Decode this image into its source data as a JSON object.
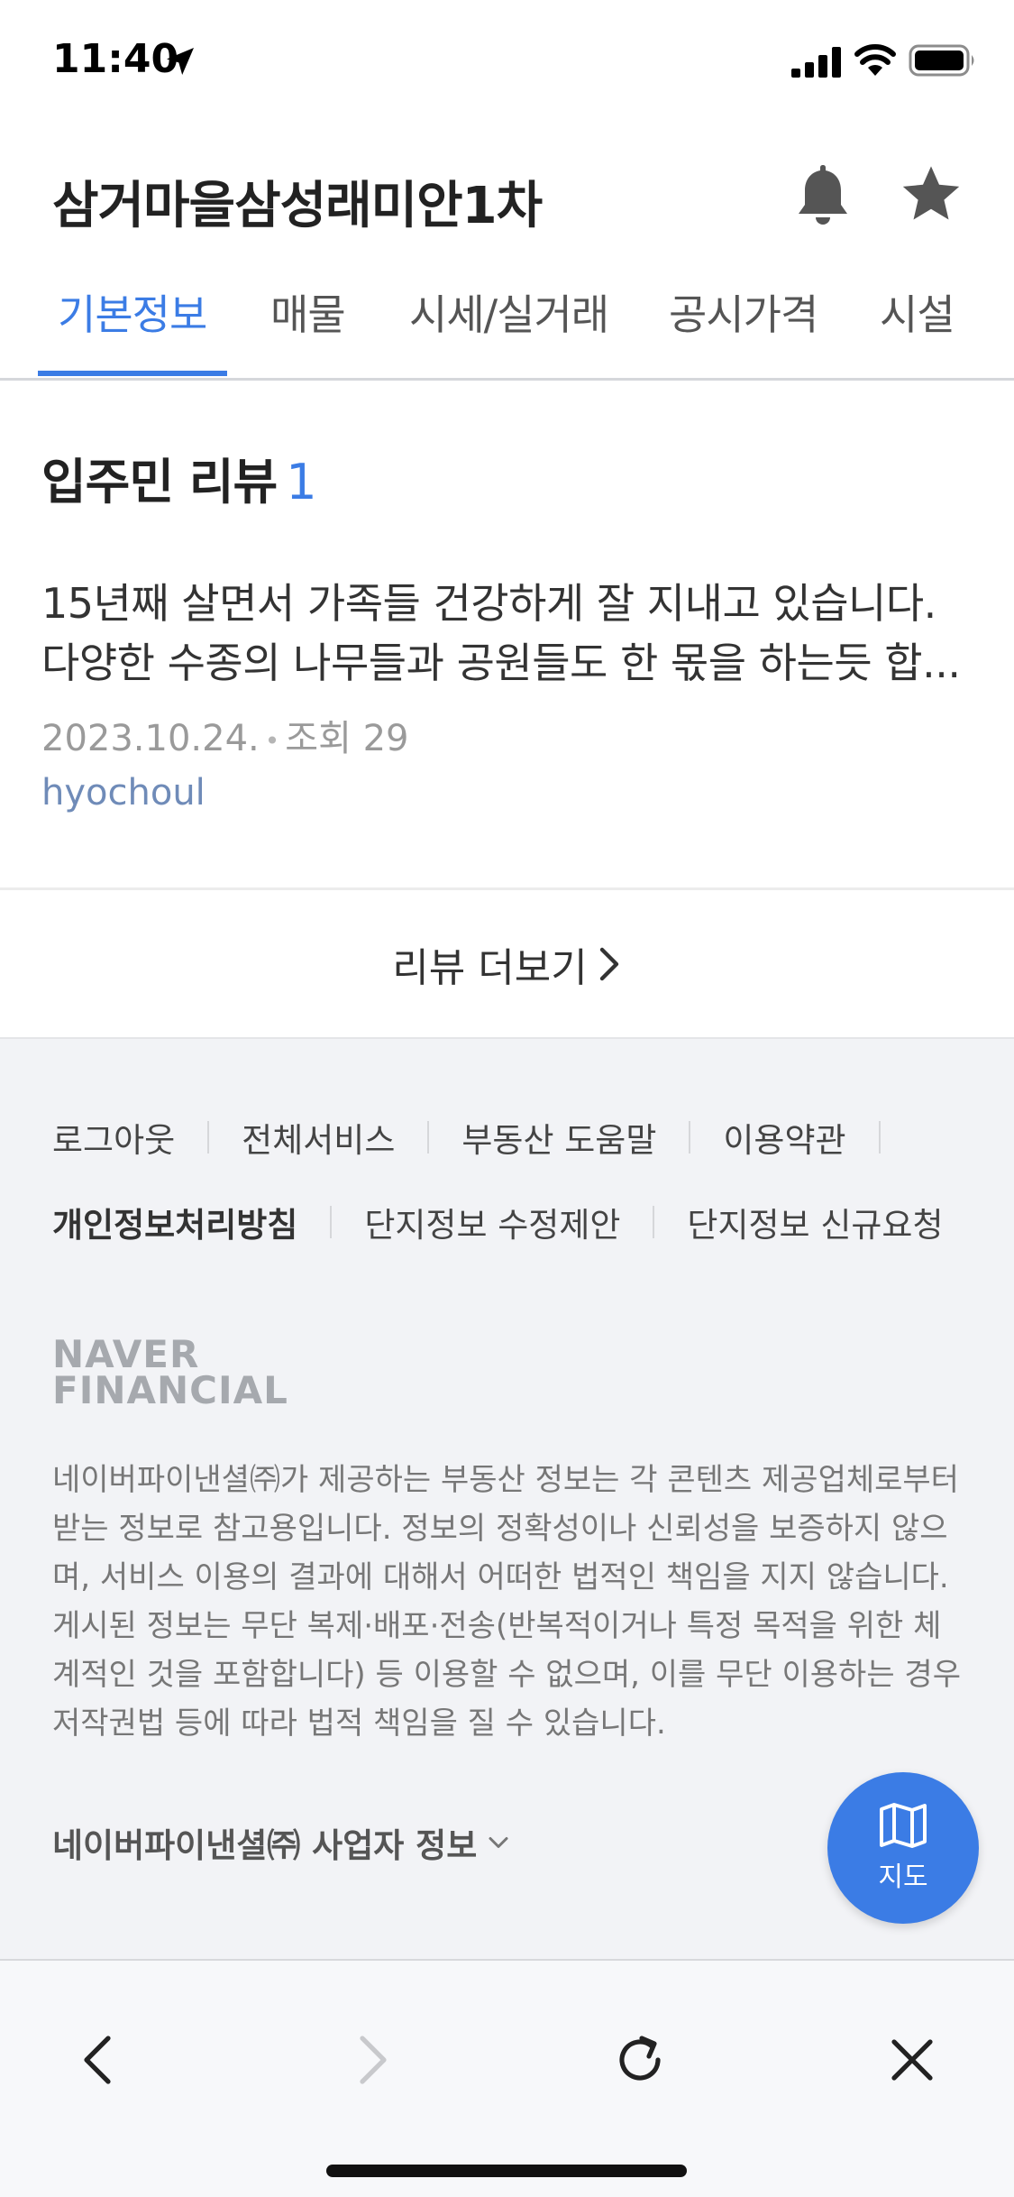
{
  "status_bar": {
    "time": "11:40"
  },
  "header": {
    "title": "삼거마을삼성래미안1차"
  },
  "tabs": [
    {
      "label": "기본정보",
      "active": true
    },
    {
      "label": "매물",
      "active": false
    },
    {
      "label": "시세/실거래",
      "active": false
    },
    {
      "label": "공시가격",
      "active": false
    },
    {
      "label": "시설",
      "active": false
    }
  ],
  "reviews": {
    "title": "입주민 리뷰",
    "count": "1",
    "items": [
      {
        "line1": "15년째 살면서 가족들 건강하게 잘 지내고 있습니다.",
        "line2": "다양한 수종의 나무들과 공원들도 한 몫을 하는듯 합...",
        "date": "2023.10.24.",
        "views": "조회 29",
        "author": "hyochoul"
      }
    ],
    "more_label": "리뷰 더보기"
  },
  "footer": {
    "links_row1": [
      "로그아웃",
      "전체서비스",
      "부동산 도움말",
      "이용약관"
    ],
    "links_row2": [
      "개인정보처리방침",
      "단지정보 수정제안",
      "단지정보 신규요청"
    ],
    "logo_line1": "NAVER",
    "logo_line2": "FINANCIAL",
    "disclaimer": "네이버파이낸셜㈜가 제공하는 부동산 정보는 각 콘텐츠 제공업체로부터 받는 정보로 참고용입니다. 정보의 정확성이나 신뢰성을 보증하지 않으며, 서비스 이용의 결과에 대해서 어떠한 법적인 책임을 지지 않습니다. 게시된 정보는 무단 복제·배포·전송(반복적이거나 특정 목적을 위한 체계적인 것을 포함합니다) 등 이용할 수 없으며, 이를 무단 이용하는 경우 저작권법 등에 따라 법적 책임을 질 수 있습니다.",
    "biz_info_label": "네이버파이낸셜㈜ 사업자 정보"
  },
  "map_fab": {
    "label": "지도"
  },
  "colors": {
    "accent": "#3b7ce5",
    "author": "#6f8bb8",
    "footer_bg": "#f2f3f6"
  }
}
